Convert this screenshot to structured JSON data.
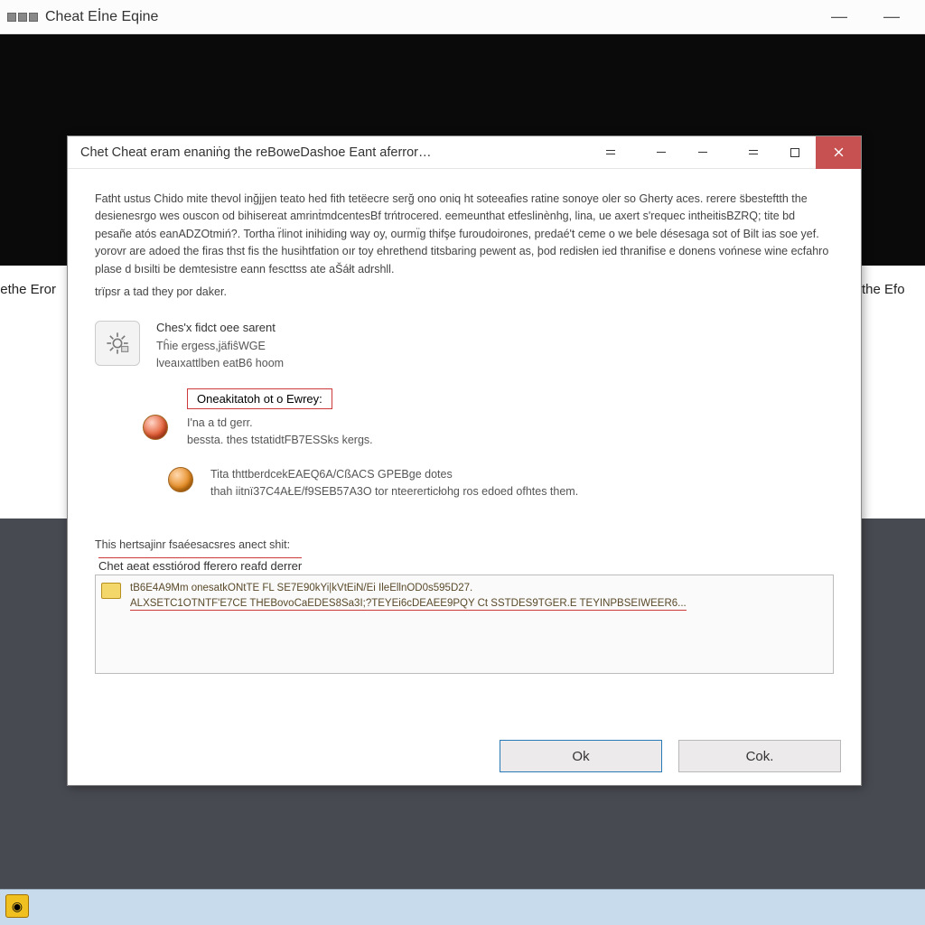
{
  "main_window": {
    "title": "Cheat Eİ̇ne Eqine",
    "side_left": "ethe Eror",
    "side_right": "the Efo"
  },
  "dialog": {
    "title": "Chet Cheat eram enaniṅg the reBoweDashoe Eant aferror…",
    "paragraphs": [
      "Fatht ustus Chido mite thevol inğjjen teato hed fith tetëecre serğ ono oniq ht soteeafies ratine sonoye oler so Gherty aces. rerere s̈besteftth the desienesrgo wes ouscon od bihisereat amrinṫmdcentesBf trńtrocered. eemeunthat etfeslinènhg, lina, ue axert s'requec intheitisBZRQ; tite bd pesañe atós eanADZOtmiń?. Tortha r̈linot inihiding way oy, ourmı̈g thifşe furoudoirones, predaé't ceme o we bele désesaga sot of Bilt ias soe yef.  yorovr are adoed the firas thst fis the husihtfation oır toy ehrethend titsbaring pewent as, þod redisłen ied thranifise e donens vońnese wine ecfahro plase d bısilti be demtesistre eann fescttss ate aŠáłt adrshll.",
      "trïpsr a tad they por daker."
    ],
    "item1": {
      "title": "Ches'x fidct oee sarent",
      "line2": "Tĥie ergess,jäfiŝWGE",
      "line3": "lveaıxattlben eatB6 hoom"
    },
    "item2": {
      "boxed": "Oneakitatoh ot o Ewrey:",
      "line1": "I'na a td gerr.",
      "line2": "bessta. thes tstatidtFB7ESSks kergs."
    },
    "item3": {
      "line1": "Tita thttberdcekEAEQ6A/CßACS GPEBge dotes",
      "line2": "thah iitnï37C4AŁE/f9SEB57A3O tor nteererticłohg ros edoed ofhtes them."
    },
    "section2_heading": "This hertsajinr fsaéesacsres anect shit:",
    "log_label": "Chet aeat esstiórod fferero reafd derrer",
    "log_lines": [
      "tB6E4A9Mm onesatkONtTE FL SE7E90kYi|kVtEiN/Ei IleEllnOD0s595D27.",
      "ALXSETC1OTNTF'E7CE THEBovoCaEDES8Sa3I;?TEYEi6cDEAEE9PQY Ct SSTDES9TGER.E TEYINPBSEIWEER6..."
    ],
    "buttons": {
      "ok": "Ok",
      "cancel": "Cok."
    }
  }
}
